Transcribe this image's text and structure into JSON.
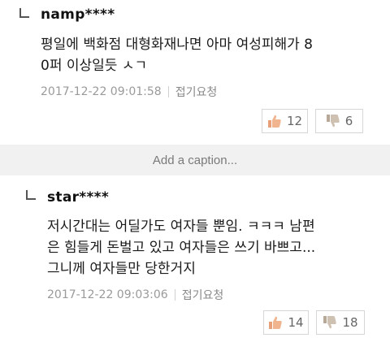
{
  "comments": [
    {
      "username": "namp****",
      "body_line1": "평일에 백화점 대형화재나면 아마 여성피해가 8",
      "body_line2": "0퍼 이상일듯 ㅅㄱ",
      "timestamp": "2017-12-22 09:01:58",
      "report_label": "접기요청",
      "likes": "12",
      "dislikes": "6"
    },
    {
      "username": "star****",
      "body_line1": "저시간대는 어딜가도 여자들 뿐임. ㅋㅋㅋ 남편",
      "body_line2": "은 힘들게 돈벌고 있고 여자들은 쓰기 바쁘고...",
      "body_line3": "그니께 여자들만 당한거지",
      "timestamp": "2017-12-22 09:03:06",
      "report_label": "접기요청",
      "likes": "14",
      "dislikes": "18"
    }
  ],
  "caption": {
    "text": "Add a caption..."
  },
  "icons": {
    "like": "thumbs-up-icon",
    "dislike": "thumbs-down-icon"
  },
  "colors": {
    "like_icon": "#e8a07a",
    "dislike_icon": "#b8a898",
    "meta_text": "#9a9a9a"
  }
}
